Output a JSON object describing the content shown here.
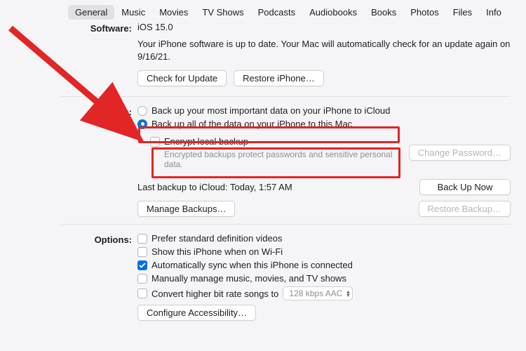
{
  "tabs": [
    "General",
    "Music",
    "Movies",
    "TV Shows",
    "Podcasts",
    "Audiobooks",
    "Books",
    "Photos",
    "Files",
    "Info"
  ],
  "active_tab": 0,
  "software": {
    "label": "Software:",
    "version": "iOS 15.0",
    "status": "Your iPhone software is up to date. Your Mac will automatically check for an update again on 9/16/21.",
    "check_btn": "Check for Update",
    "restore_btn": "Restore iPhone…"
  },
  "backups": {
    "label": "Backups:",
    "opt_icloud": "Back up your most important data on your iPhone to iCloud",
    "opt_mac": "Back up all of the data on your iPhone to this Mac",
    "encrypt_label": "Encrypt local backup",
    "encrypt_hint": "Encrypted backups protect passwords and sensitive personal data.",
    "change_pw": "Change Password…",
    "last_backup": "Last backup to iCloud:  Today, 1:57 AM",
    "backup_now": "Back Up Now",
    "manage": "Manage Backups…",
    "restore_backup": "Restore Backup…"
  },
  "options": {
    "label": "Options:",
    "sd_video": "Prefer standard definition videos",
    "show_wifi": "Show this iPhone when on Wi-Fi",
    "auto_sync": "Automatically sync when this iPhone is connected",
    "manual": "Manually manage music, movies, and TV shows",
    "bitrate": "Convert higher bit rate songs to",
    "bitrate_value": "128 kbps AAC",
    "configure": "Configure Accessibility…"
  }
}
